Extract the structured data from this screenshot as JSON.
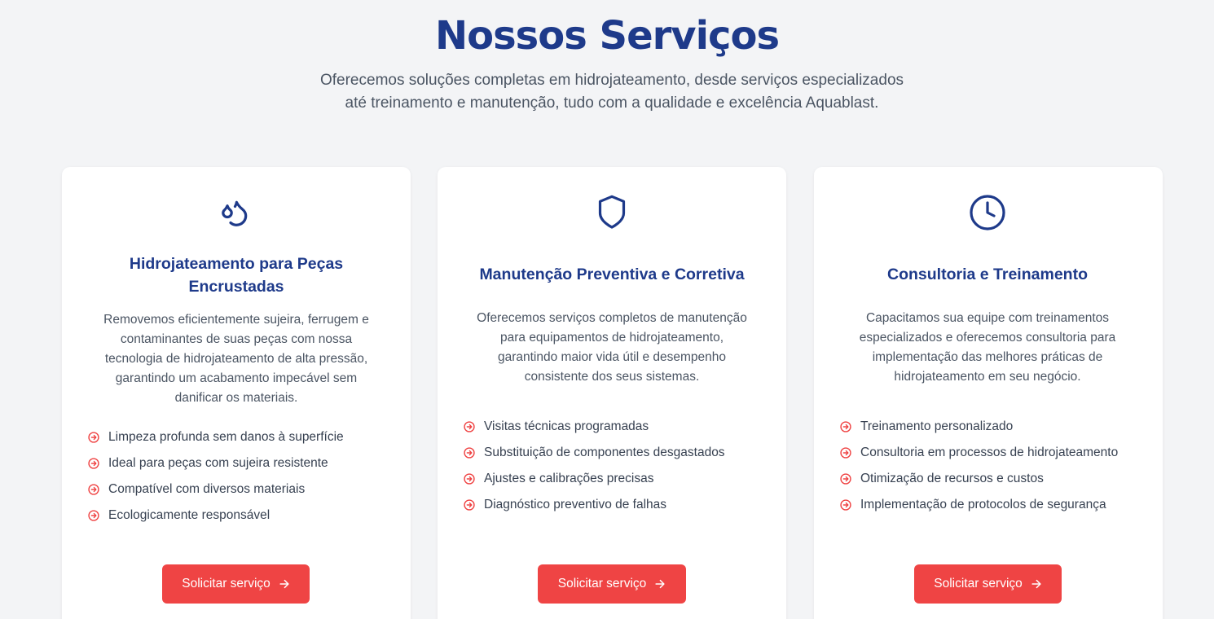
{
  "section": {
    "title": "Nossos Serviços",
    "subtitle_line1": "Oferecemos soluções completas em hidrojateamento, desde serviços especializados",
    "subtitle_line2": "até treinamento e manutenção, tudo com a qualidade e excelência Aquablast."
  },
  "colors": {
    "brand": "#1e3a8a",
    "accent": "#ef4444",
    "background": "#f3f4f6"
  },
  "cards": [
    {
      "icon": "droplets-icon",
      "title_line1": "Hidrojateamento para Peças",
      "title_line2": "Encrustadas",
      "desc_lines": [
        "Removemos eficientemente sujeira, ferrugem e",
        "contaminantes de suas peças com nossa",
        "tecnologia de hidrojateamento de alta pressão,",
        "garantindo um acabamento impecável sem",
        "danificar os materiais."
      ],
      "features": [
        "Limpeza profunda sem danos à superfície",
        "Ideal para peças com sujeira resistente",
        "Compatível com diversos materiais",
        "Ecologicamente responsável"
      ],
      "button_label": "Solicitar serviço"
    },
    {
      "icon": "shield-icon",
      "title_line1": "Manutenção Preventiva e Corretiva",
      "title_line2": "",
      "desc_lines": [
        "Oferecemos serviços completos de manutenção",
        "para equipamentos de hidrojateamento,",
        "garantindo maior vida útil e desempenho",
        "consistente dos seus sistemas."
      ],
      "features": [
        "Visitas técnicas programadas",
        "Substituição de componentes desgastados",
        "Ajustes e calibrações precisas",
        "Diagnóstico preventivo de falhas"
      ],
      "button_label": "Solicitar serviço"
    },
    {
      "icon": "clock-icon",
      "title_line1": "Consultoria e Treinamento",
      "title_line2": "",
      "desc_lines": [
        "Capacitamos sua equipe com treinamentos",
        "especializados e oferecemos consultoria para",
        "implementação das melhores práticas de",
        "hidrojateamento em seu negócio."
      ],
      "features": [
        "Treinamento personalizado",
        "Consultoria em processos de hidrojateamento",
        "Otimização de recursos e custos",
        "Implementação de protocolos de segurança"
      ],
      "button_label": "Solicitar serviço"
    }
  ]
}
